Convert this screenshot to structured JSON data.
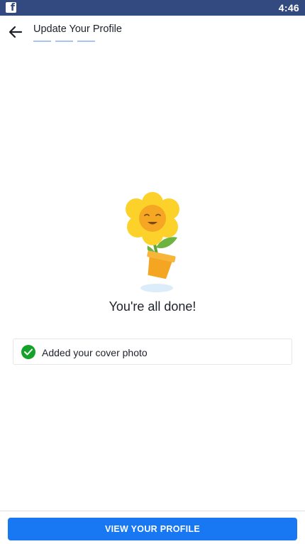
{
  "status_bar": {
    "app_icon": "facebook-icon",
    "time": "4:46",
    "bg_color": "#334a80"
  },
  "header": {
    "back_icon": "back-arrow-icon",
    "title": "Update Your Profile",
    "progress_steps": 3,
    "progress_color": "#a8c4f3"
  },
  "illustration": {
    "icon": "smiling-flower-in-pot-illustration"
  },
  "completion": {
    "title": "You're all done!"
  },
  "completed_items": [
    {
      "icon": "check-circle-icon",
      "label": "Added your cover photo",
      "status_color": "#15a22a"
    }
  ],
  "footer": {
    "cta_label": "VIEW YOUR PROFILE",
    "cta_color": "#1877f2"
  }
}
